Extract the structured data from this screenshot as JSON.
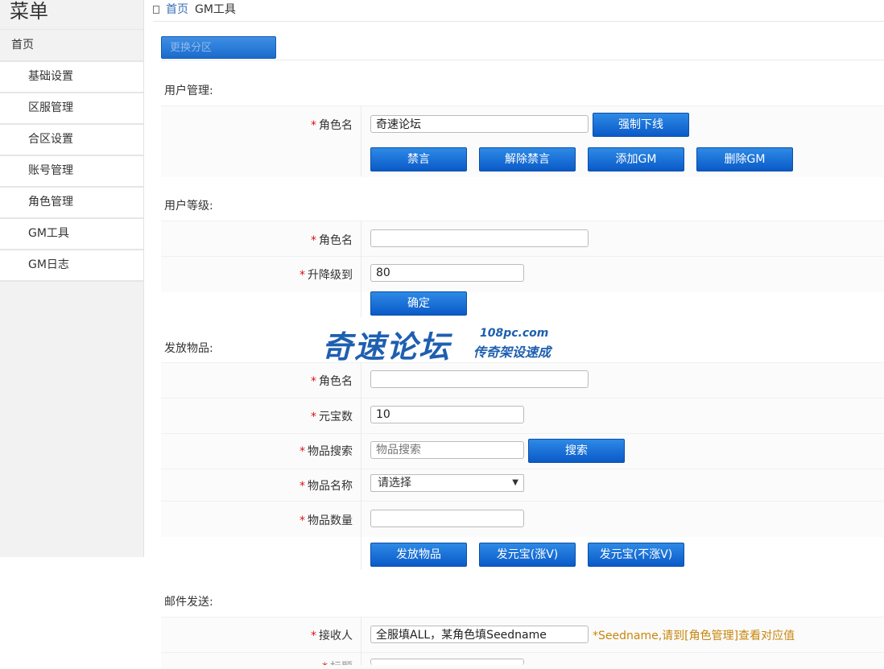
{
  "sidebar": {
    "title": "菜单",
    "home": "首页",
    "items": [
      "基础设置",
      "区服管理",
      "合区设置",
      "账号管理",
      "角色管理",
      "GM工具",
      "GM日志"
    ]
  },
  "breadcrumb": {
    "home": "首页",
    "current": "GM工具"
  },
  "server_button": "更换分区",
  "sections": {
    "user_manage": {
      "title": "用户管理:",
      "role_label": "角色名",
      "role_value": "奇速论坛",
      "kick_button": "强制下线",
      "buttons": [
        "禁言",
        "解除禁言",
        "添加GM",
        "删除GM"
      ]
    },
    "user_level": {
      "title": "用户等级:",
      "role_label": "角色名",
      "role_value": "",
      "level_label": "升降级到",
      "level_value": "80",
      "confirm_button": "确定"
    },
    "items": {
      "title": "发放物品:",
      "role_label": "角色名",
      "role_value": "",
      "yuanbao_label": "元宝数",
      "yuanbao_value": "10",
      "search_label": "物品搜索",
      "search_placeholder": "物品搜索",
      "search_button": "搜索",
      "name_label": "物品名称",
      "name_selected": "请选择",
      "qty_label": "物品数量",
      "qty_value": "",
      "buttons": [
        "发放物品",
        "发元宝(涨V)",
        "发元宝(不涨V)"
      ]
    },
    "mail": {
      "title": "邮件发送:",
      "receiver_label": "接收人",
      "receiver_value": "全服填ALL，某角色填Seedname",
      "receiver_hint": "*Seedname,请到[角色管理]查看对应值",
      "next_label": "标题"
    }
  },
  "watermark": {
    "main": "奇速论坛",
    "site": "108pc.com",
    "sub": "传奇架设速成"
  },
  "required_mark": "*"
}
